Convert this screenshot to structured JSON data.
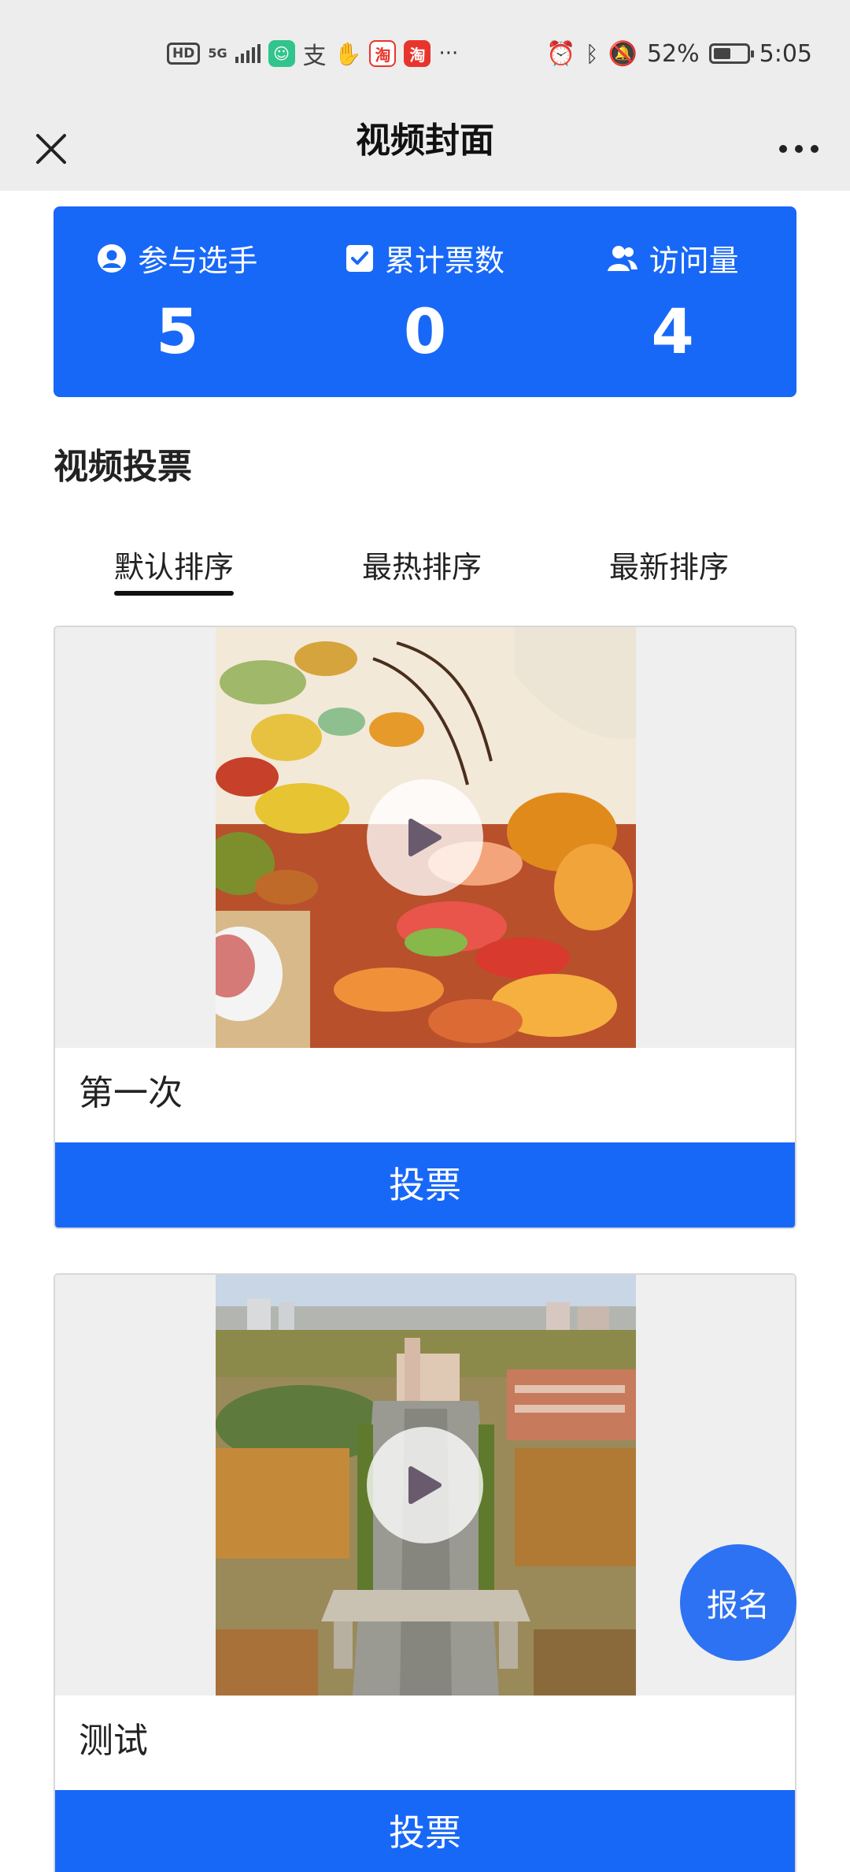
{
  "status_bar": {
    "hd": "HD",
    "network": "5G",
    "app1": "淘",
    "app2": "淘",
    "more": "···",
    "battery": "52%",
    "battery_level": 0.52,
    "time": "5:05"
  },
  "header": {
    "title": "视频封面",
    "more_label": "···"
  },
  "stats": [
    {
      "label": "参与选手",
      "value": "5",
      "icon": "user-circle-icon"
    },
    {
      "label": "累计票数",
      "value": "0",
      "icon": "checkbox-icon"
    },
    {
      "label": "访问量",
      "value": "4",
      "icon": "users-icon"
    }
  ],
  "section": {
    "title": "视频投票"
  },
  "tabs": [
    {
      "label": "默认排序",
      "active": true
    },
    {
      "label": "最热排序",
      "active": false
    },
    {
      "label": "最新排序",
      "active": false
    }
  ],
  "videos": [
    {
      "title": "第一次",
      "vote_label": "投票",
      "thumbnail": "autumn-leaves-image"
    },
    {
      "title": "测试",
      "vote_label": "投票",
      "thumbnail": "campus-aerial-image"
    }
  ],
  "floating": {
    "signup_label": "报名"
  },
  "colors": {
    "accent": "#1868f8",
    "header_bg": "#ededed",
    "signup": "#2d72f2"
  }
}
